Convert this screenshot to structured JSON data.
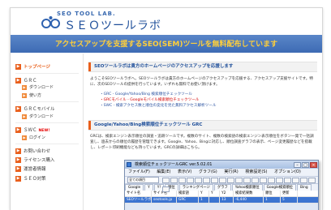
{
  "header": {
    "logo_top": "SEO TOOL LAB.",
    "logo_main": "ＳＥＯツールラボ"
  },
  "banner": {
    "text": "アクセスアップを支援するSEO(SEM)ツールを無料配布しています"
  },
  "sidebar": {
    "top": "トップページ",
    "grc": "ＧＲＣ",
    "grc_download": "ダウンロード",
    "grc_usage": "使い方",
    "grc_mobile": "ＧＲＣモバイル",
    "grc_mobile_download": "ダウンロード",
    "swc": "ＳＷＣ",
    "swc_new": "NEW!",
    "swc_login": "ログイン",
    "contact": "お問い合わせ",
    "license": "ライセンス購入",
    "company": "運営者情報",
    "seo_dict": "ＳＥＯ対策"
  },
  "main": {
    "section1_title": "SEOツールラボは貴方のホームページのアクセスアップを応援します",
    "section1_para": "ようこそSEOツールラボへ。SEOツールラボは貴方のホームページのアクセスアップを応援する、アクセスアップ支援サイトです。特に、次のSEOツールの提供を行っています。いずれも無料でお使い頂けます。",
    "link1": "・GRC - Google/Yahoo/Bing 検索順位チェックツール",
    "link2": "・GRCモバイル - Googleモバイル検索順位チェックツール",
    "link3": "・SWC - 検索アクセス数と順位の変化を見た無料アクセス解析ツール",
    "section2_title": "Google/Yahoo/Bing検索順位チェックツール GRC",
    "section2_para": "GRCは、検索エンジン表示順位の調査・追跡ツールです。複数のサイト、複数の検索語の検索エンジン表示順位をボタン一発で一括調査し、過去からの順位の履歴を管理できます。Google、Yahoo、Bingに対応し、順位調査グラフの表示、ページ変更履歴などを搭載し、レポート印刷機能なども持っています。GRCの詳細はこちら。"
  },
  "app_window": {
    "title": "検索順位チェックツールGRC  ver.5.02.01",
    "menu": [
      "ファイル(F)",
      "編集(E)",
      "表示(V)",
      "グラフ(G)",
      "実行(R)",
      "検索設定(S)",
      "オプション(O)"
    ],
    "filter_value": "全ての項目",
    "tabs": [
      "Google",
      "Y",
      "Y!",
      "順位",
      "ランキングページ",
      "グラフ",
      "Yahoo検索順位",
      "Google検索順位",
      "Bing"
    ],
    "header_row": [
      "サイト名",
      "サイト名",
      "検索語",
      "Y",
      "Y",
      "Y2",
      "検索結果数",
      "順位",
      "更新"
    ],
    "row1": [
      "SEOツールラボ",
      "seotools.jp",
      "GRC",
      "1",
      "",
      "13",
      "-6,440",
      "1",
      "5"
    ]
  }
}
